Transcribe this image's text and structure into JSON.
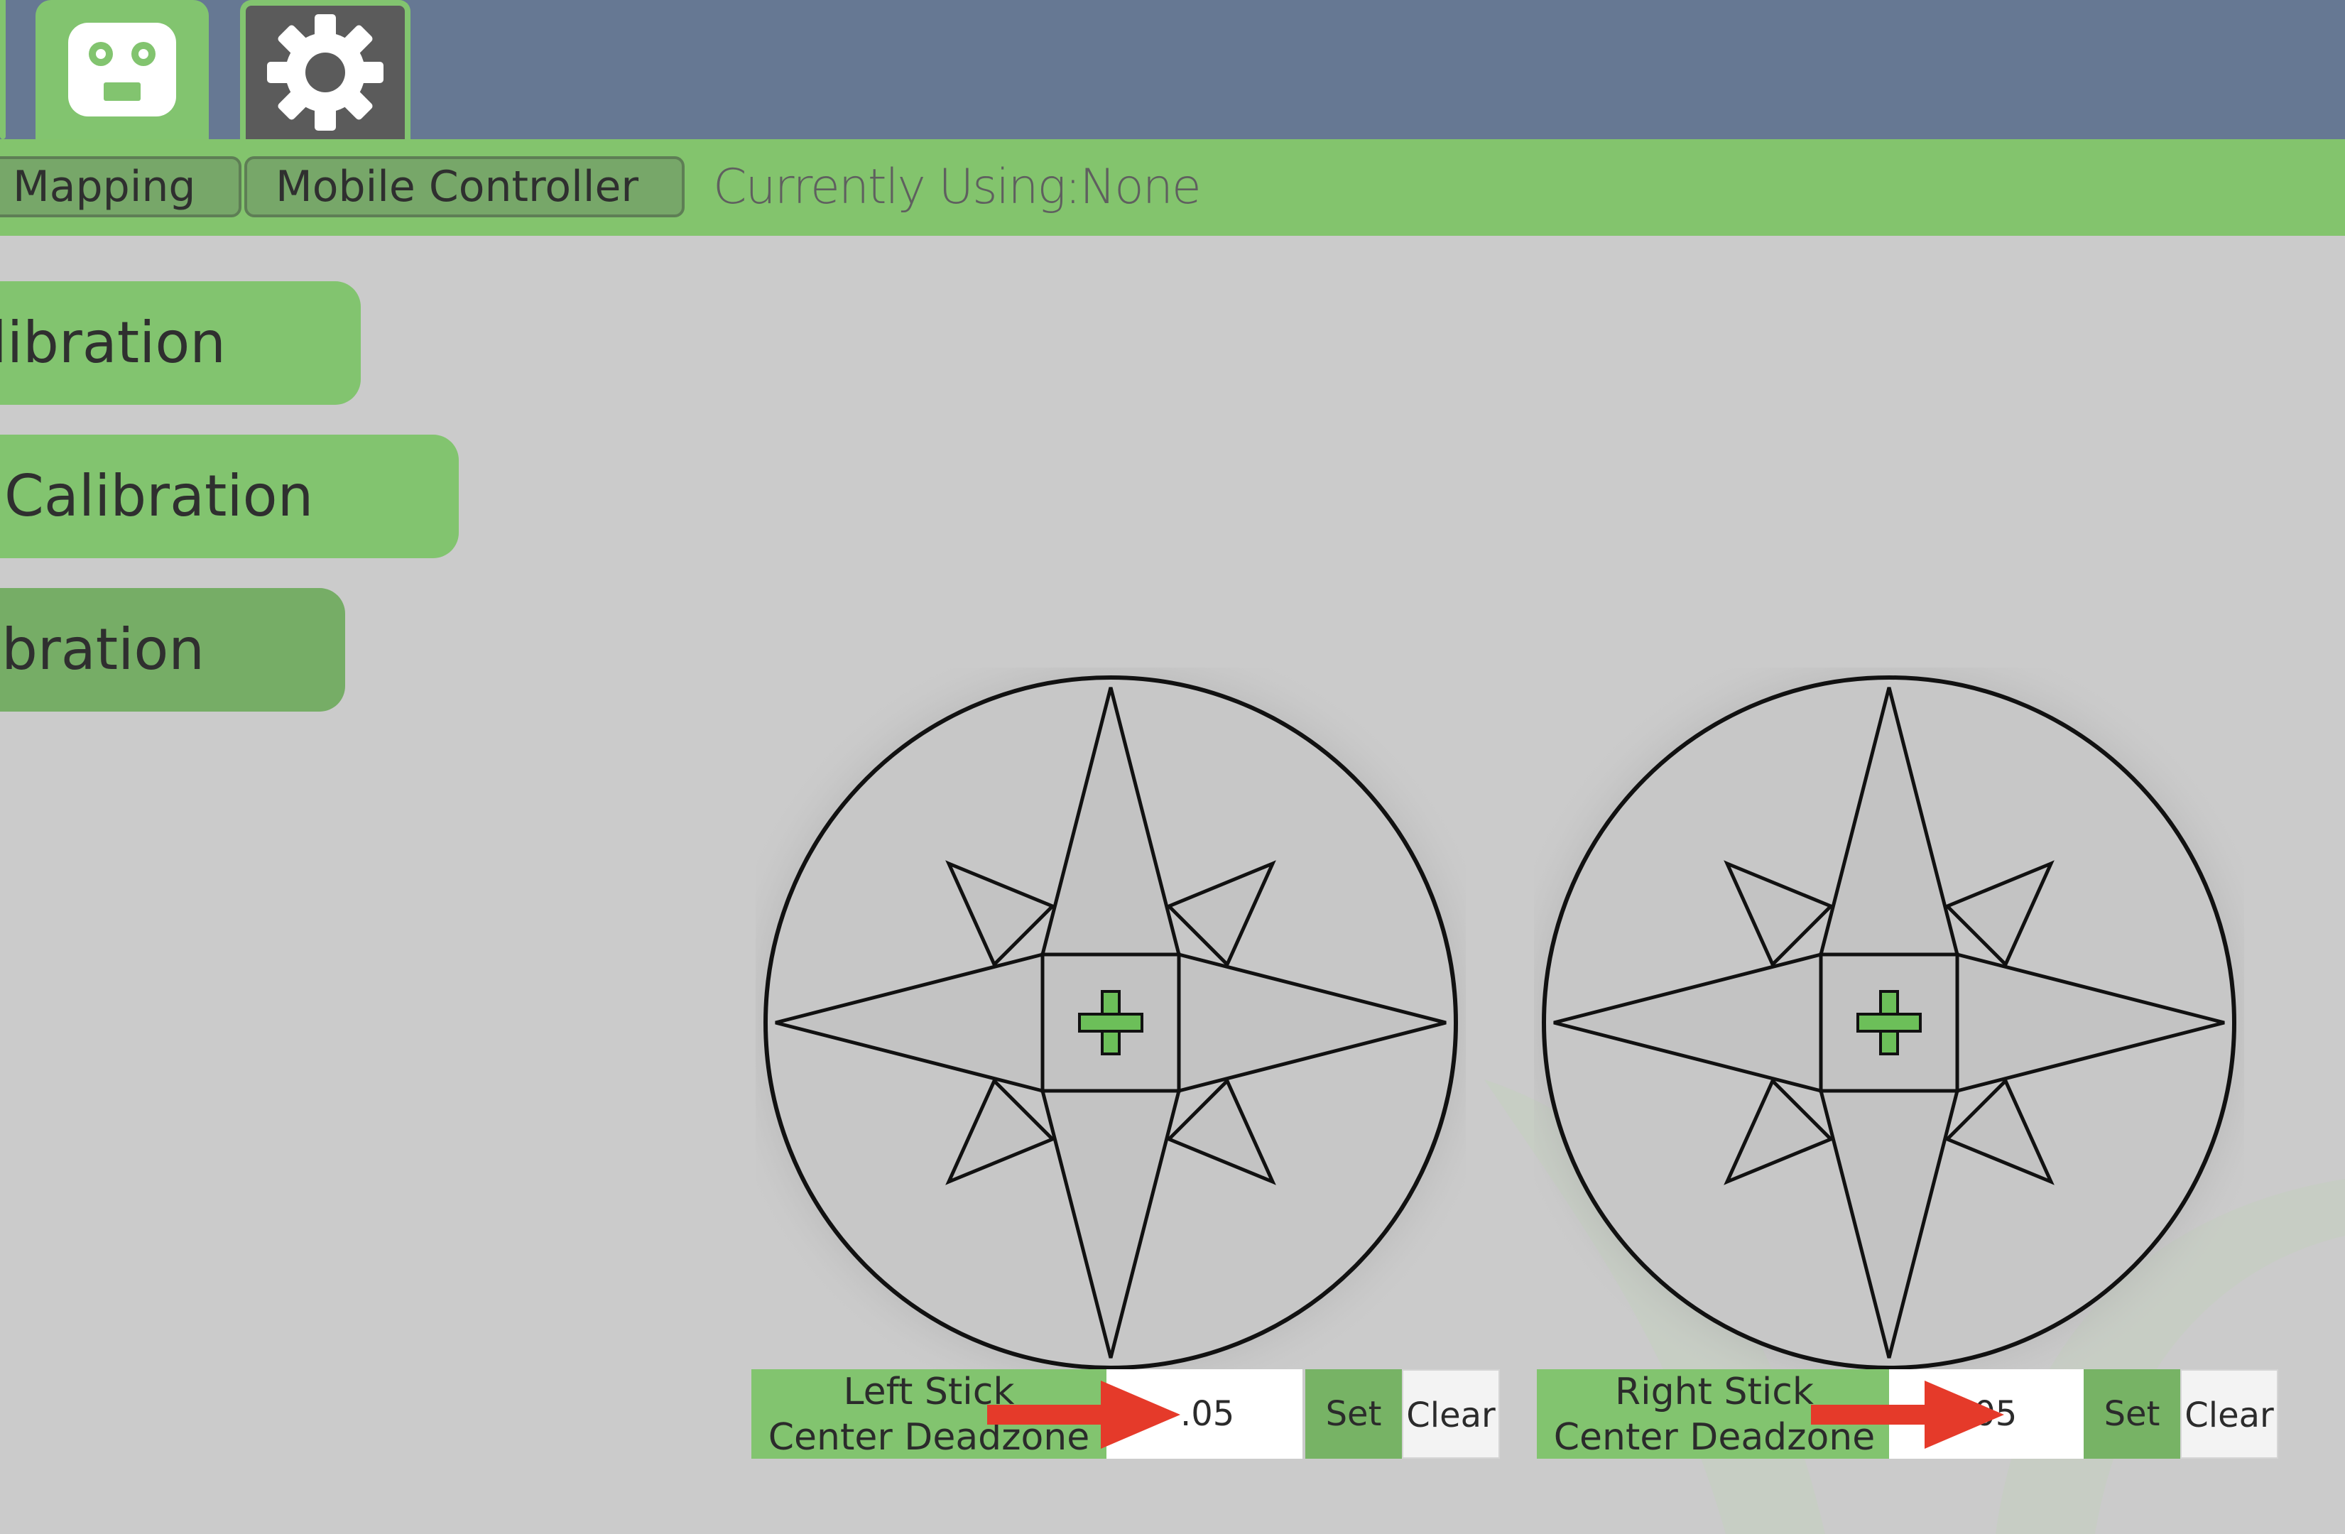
{
  "top_tabs": [
    {
      "icon": "robot-icon"
    },
    {
      "icon": "gear-icon"
    }
  ],
  "sub_tabs": {
    "mapping": "Mapping",
    "mobile_controller": "Mobile Controller",
    "currently_using": "Currently Using:None"
  },
  "sidebar": {
    "items": [
      {
        "label": "libration"
      },
      {
        "label": "Calibration"
      },
      {
        "label": "libration"
      }
    ]
  },
  "sticks": {
    "left": {
      "label_line1": "Left Stick",
      "label_line2": "Center Deadzone",
      "value": ".05",
      "set_label": "Set",
      "clear_label": "Clear"
    },
    "right": {
      "label_line1": "Right Stick",
      "label_line2": "Center Deadzone",
      "value": ".05",
      "set_label": "Set",
      "clear_label": "Clear"
    }
  },
  "colors": {
    "top_bar": "#667893",
    "accent_green": "#82c46f",
    "background": "#cbcbcb",
    "annotation_arrow": "#e53a2a"
  }
}
